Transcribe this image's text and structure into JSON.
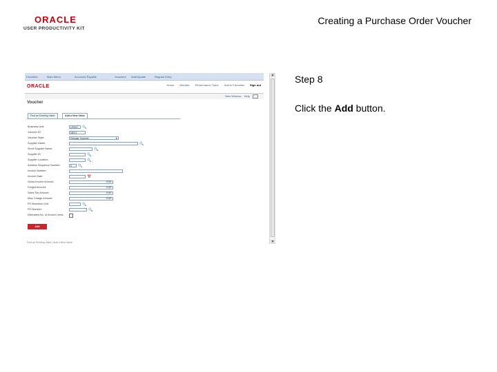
{
  "header": {
    "logo_oracle": "ORACLE",
    "logo_upk": "USER PRODUCTIVITY KIT",
    "page_title": "Creating a Purchase Order Voucher"
  },
  "screenshot": {
    "topnav": [
      "Favorites",
      "Main Menu",
      "Accounts Payable",
      "Vouchers",
      "Add/Update",
      "Regular Entry"
    ],
    "brand": "ORACLE",
    "brand_links": [
      "Home",
      "Worklist",
      "Performance Trace",
      "Add to Favorites",
      "Sign out"
    ],
    "subbar_links": [
      "New Window",
      "Help"
    ],
    "voucher_title": "Voucher",
    "tabs": [
      "Find an Existing Value",
      "Add a New Value"
    ],
    "fields": [
      {
        "label": "Business Unit:",
        "value": "US001"
      },
      {
        "label": "Voucher ID:",
        "value": "NEXT"
      },
      {
        "label": "Voucher Style:",
        "value": "Regular Voucher"
      },
      {
        "label": "Supplier Name:",
        "value": ""
      },
      {
        "label": "Short Supplier Name:",
        "value": ""
      },
      {
        "label": "Supplier ID:",
        "value": ""
      },
      {
        "label": "Supplier Location:",
        "value": ""
      },
      {
        "label": "Address Sequence Number:",
        "value": "0"
      },
      {
        "label": "Invoice Number:",
        "value": ""
      },
      {
        "label": "Invoice Date:",
        "value": ""
      },
      {
        "label": "Gross Invoice Amount:",
        "value": "0.00"
      },
      {
        "label": "Freight Amount:",
        "value": "0.00"
      },
      {
        "label": "Sales Tax Amount:",
        "value": "0.00"
      },
      {
        "label": "Misc Charge Amount:",
        "value": "0.00"
      },
      {
        "label": "PO Business Unit:",
        "value": ""
      },
      {
        "label": "PO Number:",
        "value": ""
      },
      {
        "label": "Estimated No. of Invoice Lines:",
        "value": ""
      }
    ],
    "add_button": "Add",
    "footer_links": "Find an Existing Value | Add a New Value"
  },
  "instructions": {
    "step": "Step 8",
    "text_before": "Click the ",
    "text_bold": "Add",
    "text_after": " button."
  }
}
